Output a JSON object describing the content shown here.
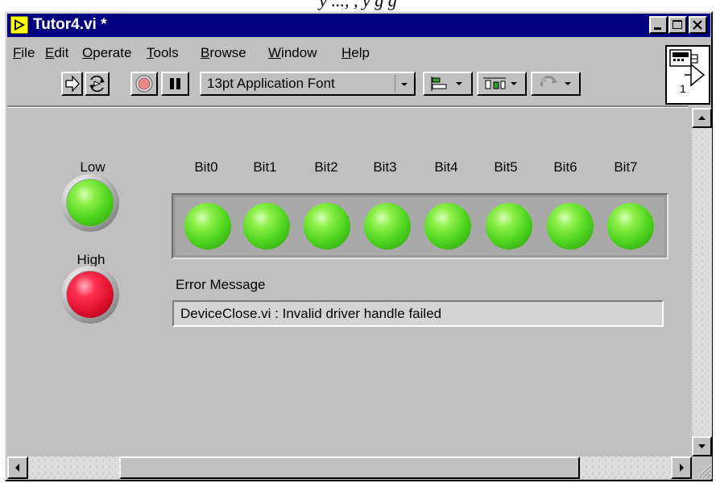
{
  "document_fragment": "y ..., , y g g",
  "window": {
    "title": "Tutor4.vi *"
  },
  "menu": [
    {
      "label": "File",
      "mnemonic": "F"
    },
    {
      "label": "Edit",
      "mnemonic": "E"
    },
    {
      "label": "Operate",
      "mnemonic": "O"
    },
    {
      "label": "Tools",
      "mnemonic": "T"
    },
    {
      "label": "Browse",
      "mnemonic": "B"
    },
    {
      "label": "Window",
      "mnemonic": "W"
    },
    {
      "label": "Help",
      "mnemonic": "H"
    }
  ],
  "toolbar": {
    "font_ring": "13pt Application Font"
  },
  "connector_pane": {
    "number": "1"
  },
  "panel": {
    "low_label": "Low",
    "high_label": "High",
    "bits": [
      "Bit0",
      "Bit1",
      "Bit2",
      "Bit3",
      "Bit4",
      "Bit5",
      "Bit6",
      "Bit7"
    ],
    "error_label": "Error Message",
    "error_value": "DeviceClose.vi : Invalid driver handle failed"
  },
  "colors": {
    "titlebar": "#000080",
    "panel": "#c0c0c0",
    "led_on_green": "#4fd51e",
    "led_on_red": "#e0102c"
  },
  "indicators": {
    "low": "on",
    "high": "on",
    "bits": [
      "on",
      "on",
      "on",
      "on",
      "on",
      "on",
      "on",
      "on"
    ]
  }
}
